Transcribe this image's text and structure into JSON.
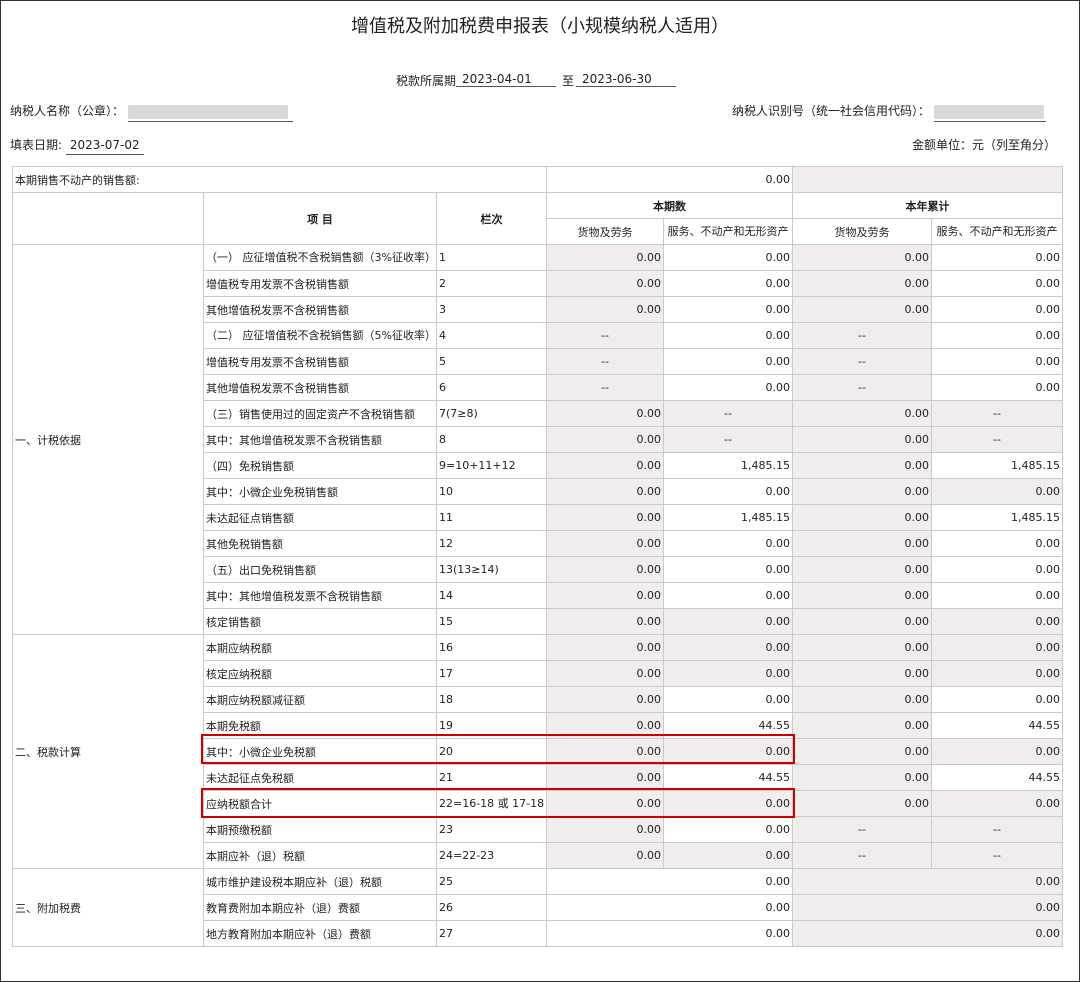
{
  "form": {
    "title": "增值税及附加税费申报表（小规模纳税人适用）",
    "period_label": "税款所属期",
    "period_start": "2023-04-01",
    "period_to": "至",
    "period_end": "2023-06-30",
    "taxpayer_name_label": "纳税人名称（公章）：",
    "taxpayer_id_label": "纳税人识别号（统一社会信用代码）：",
    "fill_date_label": "填表日期:",
    "fill_date": "2023-07-02",
    "unit_label": "金额单位：元（列至角分）"
  },
  "table": {
    "property_sales_label": "本期销售不动产的销售额:",
    "property_sales_value": "0.00",
    "header": {
      "item": "项  目",
      "col": "栏次",
      "current": "本期数",
      "ytd": "本年累计",
      "goods": "货物及劳务",
      "services": "服务、不动产和无形资产"
    },
    "groups": {
      "g1": "一、计税依据",
      "g2": "二、税款计算",
      "g3": "三、附加税费"
    },
    "rows": [
      {
        "label": "（一） 应征增值税不含税销售额（3%征收率）",
        "col": "1",
        "a": "0.00",
        "b": "0.00",
        "c": "0.00",
        "d": "0.00"
      },
      {
        "label": "增值税专用发票不含税销售额",
        "col": "2",
        "a": "0.00",
        "b": "0.00",
        "c": "0.00",
        "d": "0.00"
      },
      {
        "label": "其他增值税发票不含税销售额",
        "col": "3",
        "a": "0.00",
        "b": "0.00",
        "c": "0.00",
        "d": "0.00"
      },
      {
        "label": "（二） 应征增值税不含税销售额（5%征收率）",
        "col": "4",
        "a": "--",
        "b": "0.00",
        "c": "--",
        "d": "0.00"
      },
      {
        "label": "增值税专用发票不含税销售额",
        "col": "5",
        "a": "--",
        "b": "0.00",
        "c": "--",
        "d": "0.00"
      },
      {
        "label": "其他增值税发票不含税销售额",
        "col": "6",
        "a": "--",
        "b": "0.00",
        "c": "--",
        "d": "0.00"
      },
      {
        "label": "（三）销售使用过的固定资产不含税销售额",
        "col": "7(7≥8)",
        "a": "0.00",
        "b": "--",
        "c": "0.00",
        "d": "--"
      },
      {
        "label": "其中：其他增值税发票不含税销售额",
        "col": "8",
        "a": "0.00",
        "b": "--",
        "c": "0.00",
        "d": "--"
      },
      {
        "label": "（四）免税销售额",
        "col": "9=10+11+12",
        "a": "0.00",
        "b": "1,485.15",
        "c": "0.00",
        "d": "1,485.15"
      },
      {
        "label": "其中：小微企业免税销售额",
        "col": "10",
        "a": "0.00",
        "b": "0.00",
        "c": "0.00",
        "d": "0.00"
      },
      {
        "label": "未达起征点销售额",
        "col": "11",
        "a": "0.00",
        "b": "1,485.15",
        "c": "0.00",
        "d": "1,485.15"
      },
      {
        "label": "其他免税销售额",
        "col": "12",
        "a": "0.00",
        "b": "0.00",
        "c": "0.00",
        "d": "0.00"
      },
      {
        "label": "（五）出口免税销售额",
        "col": "13(13≥14)",
        "a": "0.00",
        "b": "0.00",
        "c": "0.00",
        "d": "0.00"
      },
      {
        "label": "其中：其他增值税发票不含税销售额",
        "col": "14",
        "a": "0.00",
        "b": "0.00",
        "c": "0.00",
        "d": "0.00"
      },
      {
        "label": "核定销售额",
        "col": "15",
        "a": "0.00",
        "b": "0.00",
        "c": "0.00",
        "d": "0.00"
      },
      {
        "label": "本期应纳税额",
        "col": "16",
        "a": "0.00",
        "b": "0.00",
        "c": "0.00",
        "d": "0.00"
      },
      {
        "label": "核定应纳税额",
        "col": "17",
        "a": "0.00",
        "b": "0.00",
        "c": "0.00",
        "d": "0.00"
      },
      {
        "label": "本期应纳税额减征额",
        "col": "18",
        "a": "0.00",
        "b": "0.00",
        "c": "0.00",
        "d": "0.00"
      },
      {
        "label": "本期免税额",
        "col": "19",
        "a": "0.00",
        "b": "44.55",
        "c": "0.00",
        "d": "44.55"
      },
      {
        "label": "其中：小微企业免税额",
        "col": "20",
        "a": "0.00",
        "b": "0.00",
        "c": "0.00",
        "d": "0.00"
      },
      {
        "label": "未达起征点免税额",
        "col": "21",
        "a": "0.00",
        "b": "44.55",
        "c": "0.00",
        "d": "44.55"
      },
      {
        "label": "应纳税额合计",
        "col": "22=16-18 或 17-18",
        "a": "0.00",
        "b": "0.00",
        "c": "0.00",
        "d": "0.00"
      },
      {
        "label": "本期预缴税额",
        "col": "23",
        "a": "0.00",
        "b": "0.00",
        "c": "--",
        "d": "--"
      },
      {
        "label": "本期应补（退）税额",
        "col": "24=22-23",
        "a": "0.00",
        "b": "0.00",
        "c": "--",
        "d": "--"
      },
      {
        "label": "城市维护建设税本期应补（退）税额",
        "col": "25",
        "ab": "0.00",
        "cd": "0.00"
      },
      {
        "label": "教育费附加本期应补（退）费额",
        "col": "26",
        "ab": "0.00",
        "cd": "0.00"
      },
      {
        "label": "地方教育附加本期应补（退）费额",
        "col": "27",
        "ab": "0.00",
        "cd": "0.00"
      }
    ]
  }
}
